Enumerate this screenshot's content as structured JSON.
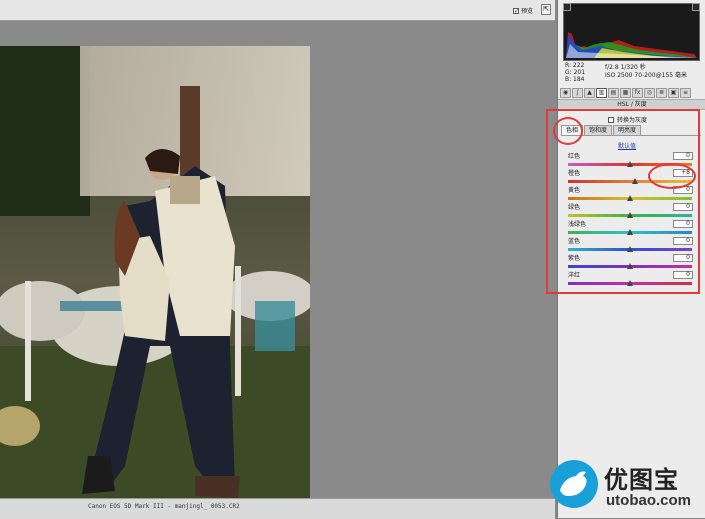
{
  "toolbar": {
    "preview_label": "预览",
    "preview_checked": "✓"
  },
  "status_bar": {
    "text": "Canon EOS 5D Mark III - manjingl_ 0053.CR2"
  },
  "readout": {
    "r": "R:  222",
    "g": "G:  201",
    "b": "B:  184",
    "aperture_shutter": "f/2.8   1/320 秒",
    "iso_lens": "ISO 2500   70-200@155 毫米"
  },
  "panel": {
    "title": "HSL / 灰度",
    "convert_grayscale": "转换为灰度",
    "tabs": [
      {
        "label": "色相"
      },
      {
        "label": "饱和度"
      },
      {
        "label": "明亮度"
      }
    ],
    "default_link": "默认值",
    "sliders": [
      {
        "label": "红色",
        "value": "0",
        "fraction": 0.5
      },
      {
        "label": "橙色",
        "value": "+8",
        "fraction": 0.54
      },
      {
        "label": "黄色",
        "value": "0",
        "fraction": 0.5
      },
      {
        "label": "绿色",
        "value": "0",
        "fraction": 0.5
      },
      {
        "label": "浅绿色",
        "value": "0",
        "fraction": 0.5
      },
      {
        "label": "蓝色",
        "value": "0",
        "fraction": 0.5
      },
      {
        "label": "紫色",
        "value": "0",
        "fraction": 0.5
      },
      {
        "label": "洋红",
        "value": "0",
        "fraction": 0.5
      }
    ]
  },
  "watermark": {
    "title": "优图宝",
    "url": "utobao.com"
  },
  "colors": {
    "annotation": "#e23a3a",
    "link": "#1a3fa8",
    "brand": "#1aa0d8"
  }
}
